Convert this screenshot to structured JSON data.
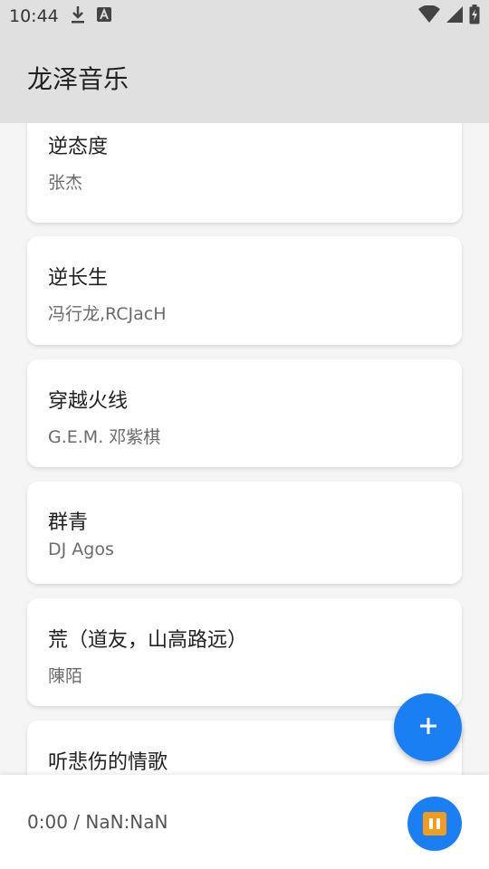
{
  "status_bar": {
    "time": "10:44",
    "icons": [
      "download-icon",
      "a-text-icon",
      "wifi-icon",
      "signal-icon",
      "battery-charging-icon"
    ]
  },
  "app_bar": {
    "title": "龙泽音乐"
  },
  "songs": [
    {
      "title": "逆态度",
      "artist": "张杰"
    },
    {
      "title": "逆长生",
      "artist": "冯行龙,RCJacH"
    },
    {
      "title": "穿越火线",
      "artist": "G.E.M. 邓紫棋"
    },
    {
      "title": "群青",
      "artist": "DJ Agos"
    },
    {
      "title": "荒（道友，山高路远）",
      "artist": "陳陌"
    },
    {
      "title": "听悲伤的情歌",
      "artist": ""
    }
  ],
  "fab": {
    "icon": "plus-icon"
  },
  "player": {
    "time_text": "0:00 / NaN:NaN",
    "play_icon": "pause-icon"
  },
  "colors": {
    "accent": "#1a7ff2",
    "pause_icon": "#f39c1f",
    "bar_bg": "#e0e0e0"
  }
}
